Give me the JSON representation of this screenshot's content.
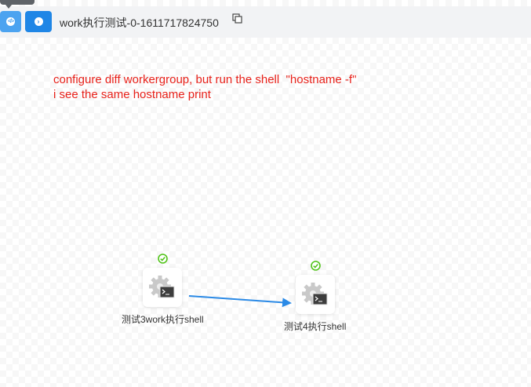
{
  "toolbar": {
    "code_button_icon": "code-icon",
    "run_button_icon": "chevron-right-icon",
    "title": "work执行测试-0-1611717824750",
    "copy_icon": "copy-icon"
  },
  "annotation": {
    "line1": "configure diff workergroup, but run the shell  \"hostname -f\"",
    "line2": "i see the same hostname print",
    "color": "#e8221b"
  },
  "nodes": [
    {
      "label": "测试3work执行shell",
      "type_icon": "shell-task-icon",
      "status_icon": "success-check-icon",
      "status_color": "#52c41a"
    },
    {
      "label": "测试4执行shell",
      "type_icon": "shell-task-icon",
      "status_icon": "success-check-icon",
      "status_color": "#52c41a"
    }
  ],
  "edge": {
    "color": "#2b8ae6"
  }
}
